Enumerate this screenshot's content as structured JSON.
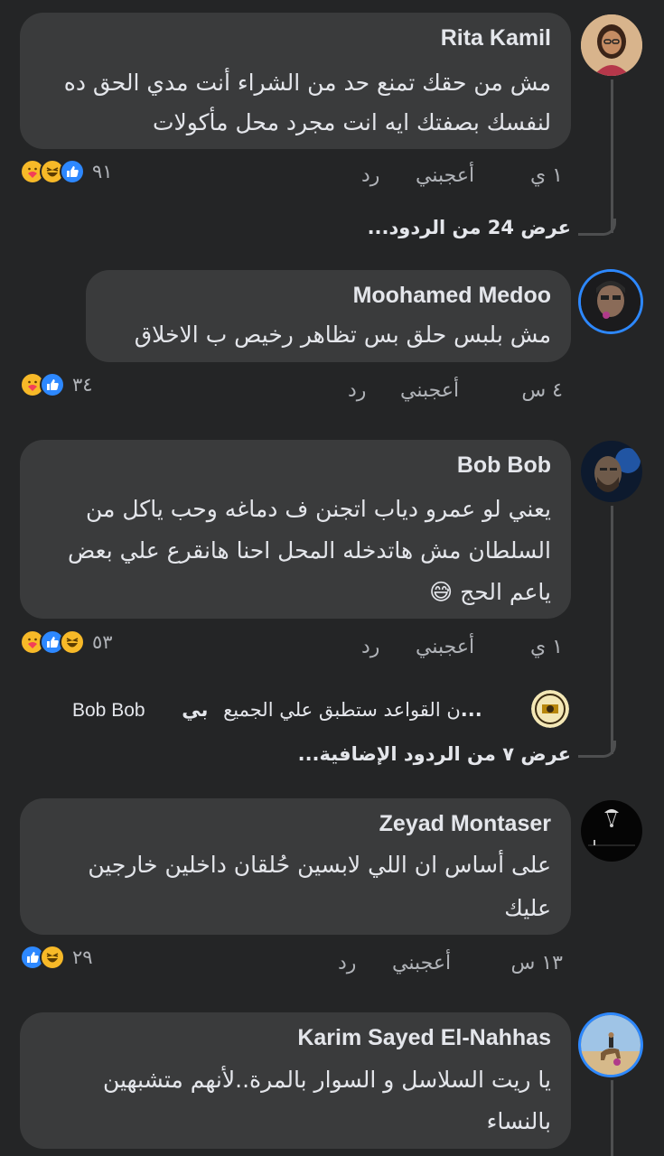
{
  "comments": [
    {
      "name": "Rita Kamil",
      "text": "مش من حقك تمنع حد من الشراء أنت مدي الحق ده لنفسك بصفتك ايه انت مجرد محل مأكولات",
      "time": "١ ي",
      "like_label": "أعجبني",
      "reply_label": "رد",
      "reaction_count": "٩١",
      "reactions": [
        "like-icon",
        "haha-icon",
        "care-icon"
      ],
      "view_more": "عرض 24 من الردود..."
    },
    {
      "name": "Moohamed Medoo",
      "text": "مش بلبس حلق بس تظاهر رخيص ب الاخلاق",
      "time": "٤ س",
      "like_label": "أعجبني",
      "reply_label": "رد",
      "reaction_count": "٣٤",
      "reactions": [
        "like-icon",
        "care-icon"
      ]
    },
    {
      "name": "Bob Bob",
      "text": "يعني لو عمرو دياب اتجنن ف دماغه وحب ياكل من السلطان مش هاتدخله المحل احنا هانقرع علي بعض ياعم الحج 😅",
      "time": "١ ي",
      "like_label": "أعجبني",
      "reply_label": "رد",
      "reaction_count": "٥٣",
      "reactions": [
        "haha-icon",
        "like-icon",
        "care-icon"
      ],
      "reply_preview": {
        "author": "بي...",
        "text": "ن القواعد ستطبق علي الجميع",
        "mention": "Bob Bob"
      },
      "view_more": "عرض ٧ من الردود الإضافية..."
    },
    {
      "name": "Zeyad Montaser",
      "text": "على أساس ان اللي لابسين حُلقان داخلين خارجين عليك",
      "time": "١٣ س",
      "like_label": "أعجبني",
      "reply_label": "رد",
      "reaction_count": "٢٩",
      "reactions": [
        "haha-icon",
        "like-icon"
      ]
    },
    {
      "name": "Karim Sayed El-Nahhas",
      "text": "يا ريت السلاسل و السوار بالمرة..لأنهم متشبهين بالنساء"
    }
  ],
  "colors": {
    "background": "#242526",
    "bubble": "#3a3b3c",
    "like_blue": "#2d88ff",
    "haha_yellow": "#f7b928",
    "meta_gray": "#b0b3b8"
  }
}
